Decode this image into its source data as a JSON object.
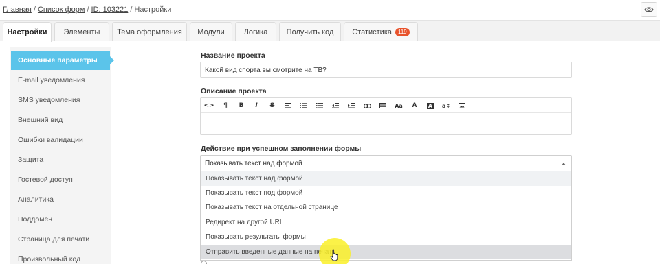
{
  "breadcrumb": {
    "home": "Главная",
    "forms": "Список форм",
    "id": "ID: 103221",
    "current": "Настройки",
    "separator": "/"
  },
  "header": {
    "preview_icon": "eye-icon"
  },
  "tabs": [
    {
      "label": "Настройки",
      "active": true
    },
    {
      "label": "Элементы"
    },
    {
      "label": "Тема оформления"
    },
    {
      "label": "Модули"
    },
    {
      "label": "Логика"
    },
    {
      "label": "Получить код"
    },
    {
      "label": "Статистика",
      "badge": "119"
    }
  ],
  "sidebar": {
    "items": [
      {
        "label": "Основные параметры",
        "active": true
      },
      {
        "label": "E-mail уведомления"
      },
      {
        "label": "SMS уведомления"
      },
      {
        "label": "Внешний вид"
      },
      {
        "label": "Ошибки валидации"
      },
      {
        "label": "Защита"
      },
      {
        "label": "Гостевой доступ"
      },
      {
        "label": "Аналитика"
      },
      {
        "label": "Поддомен"
      },
      {
        "label": "Страница для печати"
      },
      {
        "label": "Произвольный код"
      }
    ]
  },
  "main": {
    "project_name_label": "Название проекта",
    "project_name_value": "Какой вид спорта вы смотрите на ТВ?",
    "description_label": "Описание проекта",
    "toolbar": {
      "code": "<>",
      "paragraph": "¶",
      "bold": "B",
      "italic": "I",
      "strike": "S",
      "font_size": "Aa",
      "text_color": "A",
      "bg_color": "A",
      "case": "a↕"
    },
    "action_label": "Действие при успешном заполнении формы",
    "action_selected": "Показывать текст над формой",
    "action_options": [
      "Показывать текст над формой",
      "Показывать текст под формой",
      "Показывать текст на отдельной странице",
      "Редирект на другой URL",
      "Показывать результаты формы",
      "Отправить введенные данные на печать"
    ]
  },
  "colors": {
    "accent": "#5bc4ea",
    "badge": "#e8532c",
    "cursor_highlight": "#faf028"
  }
}
